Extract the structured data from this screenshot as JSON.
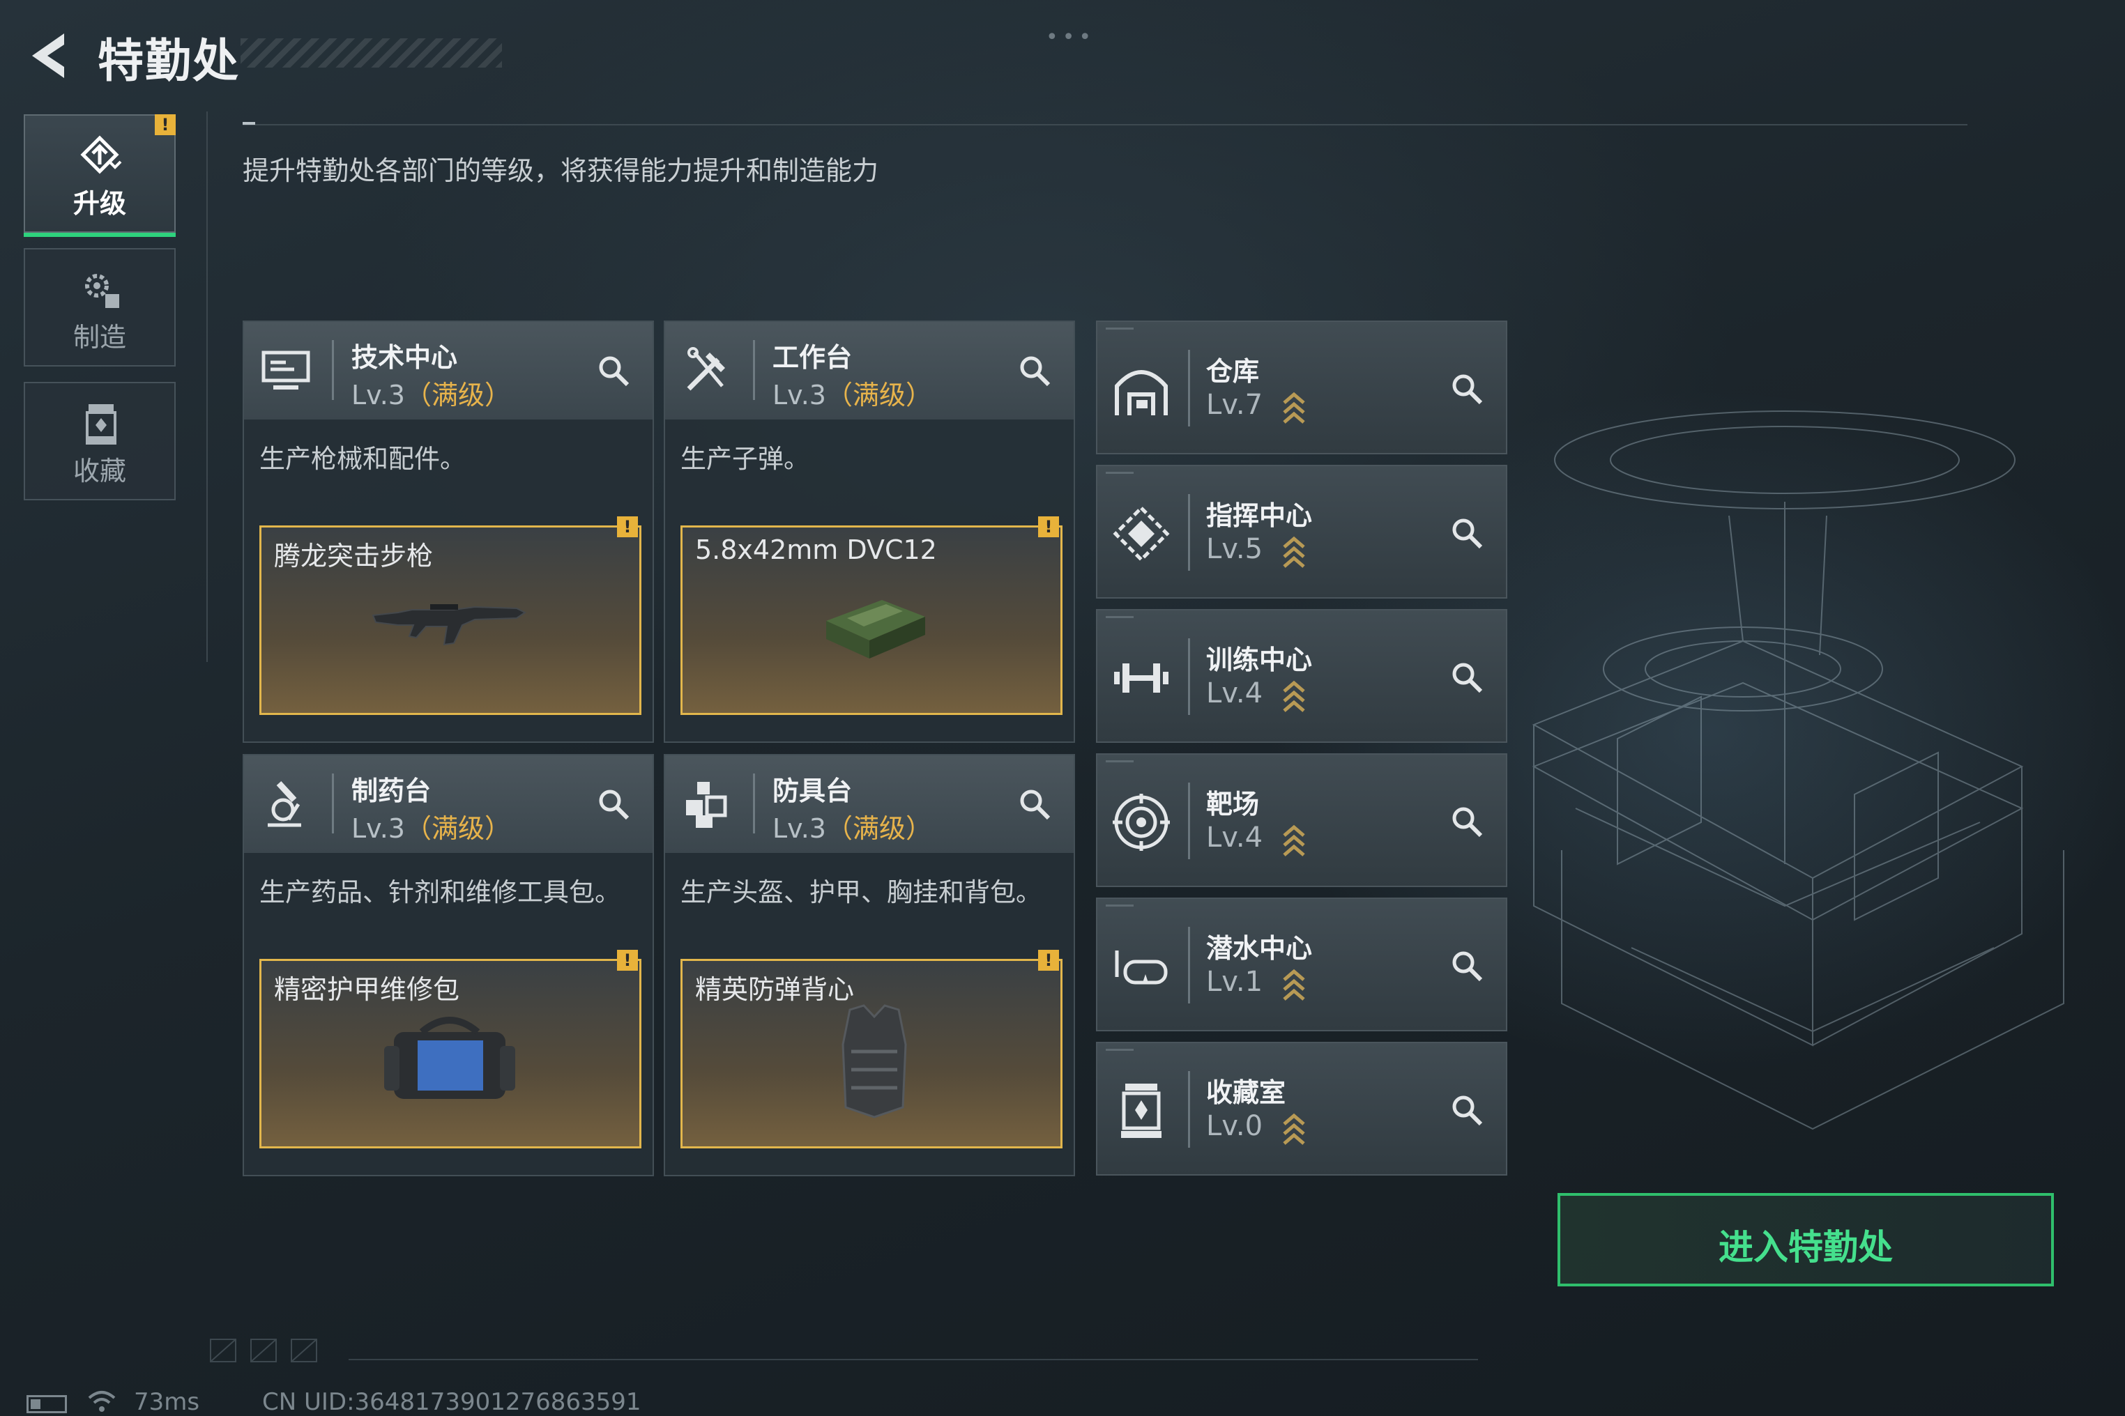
{
  "header": {
    "title": "特勤处",
    "subtitle": "提升特勤处各部门的等级，将获得能力提升和制造能力"
  },
  "sidebar": {
    "items": [
      {
        "label": "升级",
        "icon": "upgrade-icon",
        "active": true,
        "badge": "!"
      },
      {
        "label": "制造",
        "icon": "gears-icon",
        "active": false
      },
      {
        "label": "收藏",
        "icon": "collection-icon",
        "active": false
      }
    ]
  },
  "production": [
    {
      "name": "技术中心",
      "level": "Lv.3",
      "max": "（满级）",
      "desc": "生产枪械和配件。",
      "item": "腾龙突击步枪",
      "icon": "computer-icon",
      "badge": "!"
    },
    {
      "name": "工作台",
      "level": "Lv.3",
      "max": "（满级）",
      "desc": "生产子弹。",
      "item": "5.8x42mm DVC12",
      "icon": "tools-icon",
      "badge": "!"
    },
    {
      "name": "制药台",
      "level": "Lv.3",
      "max": "（满级）",
      "desc": "生产药品、针剂和维修工具包。",
      "item": "精密护甲维修包",
      "icon": "microscope-icon",
      "badge": "!"
    },
    {
      "name": "防具台",
      "level": "Lv.3",
      "max": "（满级）",
      "desc": "生产头盔、护甲、胸挂和背包。",
      "item": "精英防弹背心",
      "icon": "armor-icon",
      "badge": "!"
    }
  ],
  "facilities": [
    {
      "name": "仓库",
      "level": "Lv.7",
      "icon": "warehouse-icon"
    },
    {
      "name": "指挥中心",
      "level": "Lv.5",
      "icon": "command-icon"
    },
    {
      "name": "训练中心",
      "level": "Lv.4",
      "icon": "dumbbell-icon"
    },
    {
      "name": "靶场",
      "level": "Lv.4",
      "icon": "target-icon"
    },
    {
      "name": "潜水中心",
      "level": "Lv.1",
      "icon": "diving-mask-icon"
    },
    {
      "name": "收藏室",
      "level": "Lv.0",
      "icon": "trophy-case-icon"
    }
  ],
  "enter_button": "进入特勤处",
  "status": {
    "ping": "73ms",
    "uid": "CN UID:3648173901276863591"
  },
  "colors": {
    "accent_green": "#2fbf6c",
    "max_level": "#e7b34b",
    "badge": "#e8b23a"
  }
}
